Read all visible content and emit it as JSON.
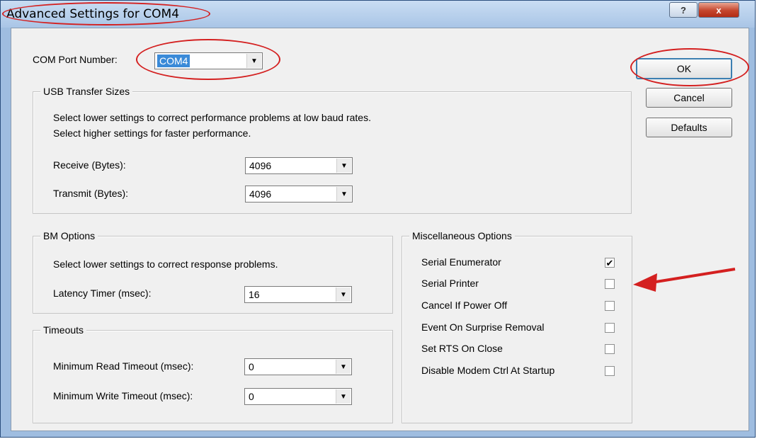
{
  "window": {
    "title": "Advanced Settings for COM4",
    "help_label": "?",
    "close_label": "x"
  },
  "com_port": {
    "label": "COM Port Number:",
    "value": "COM4"
  },
  "usb": {
    "legend": "USB Transfer Sizes",
    "desc1": "Select lower settings to correct performance problems at low baud rates.",
    "desc2": "Select higher settings for faster performance.",
    "receive_label": "Receive (Bytes):",
    "receive_value": "4096",
    "transmit_label": "Transmit (Bytes):",
    "transmit_value": "4096"
  },
  "bm": {
    "legend": "BM Options",
    "desc": "Select lower settings to correct response problems.",
    "latency_label": "Latency Timer (msec):",
    "latency_value": "16"
  },
  "timeouts": {
    "legend": "Timeouts",
    "read_label": "Minimum Read Timeout (msec):",
    "read_value": "0",
    "write_label": "Minimum Write Timeout (msec):",
    "write_value": "0"
  },
  "misc": {
    "legend": "Miscellaneous Options",
    "options": [
      {
        "label": "Serial Enumerator",
        "checked": true
      },
      {
        "label": "Serial Printer",
        "checked": false
      },
      {
        "label": "Cancel If Power Off",
        "checked": false
      },
      {
        "label": "Event On Surprise Removal",
        "checked": false
      },
      {
        "label": "Set RTS On Close",
        "checked": false
      },
      {
        "label": "Disable Modem Ctrl At Startup",
        "checked": false
      }
    ]
  },
  "buttons": {
    "ok": "OK",
    "cancel": "Cancel",
    "defaults": "Defaults"
  },
  "annotation": {
    "color": "#d42020"
  }
}
